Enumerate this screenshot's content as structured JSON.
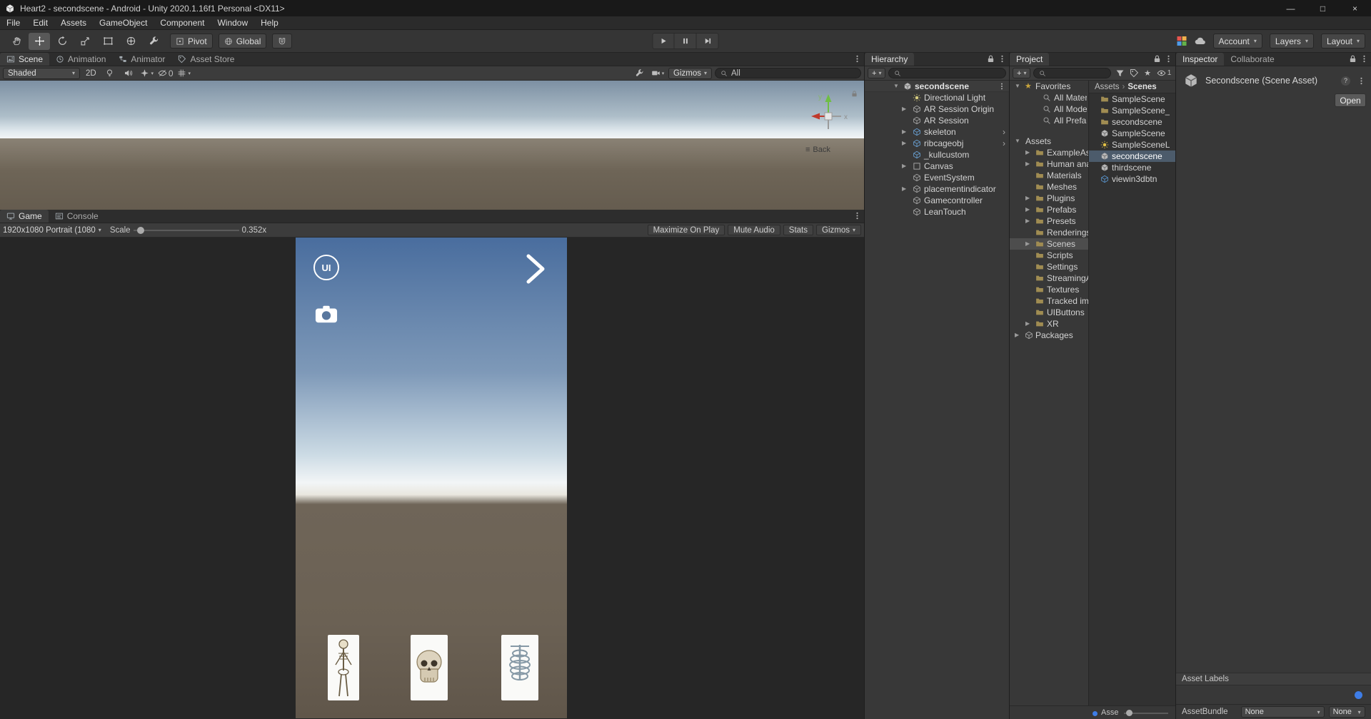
{
  "ui": {
    "caret": "▾",
    "expand": "▶",
    "collapse": "▼",
    "plus": "+",
    "sep": "›",
    "star": "★",
    "menu": "≡",
    "help": "?",
    "prefab_arrow": "›"
  },
  "window": {
    "title": "Heart2 - secondscene - Android - Unity 2020.1.16f1 Personal <DX11>",
    "minimize": "—",
    "maximize": "□",
    "close": "×"
  },
  "menu": {
    "items": [
      "File",
      "Edit",
      "Assets",
      "GameObject",
      "Component",
      "Window",
      "Help"
    ]
  },
  "toolbar": {
    "pivot": "Pivot",
    "global": "Global",
    "account": "Account",
    "layers": "Layers",
    "layout": "Layout"
  },
  "scene": {
    "tabs": [
      "Scene",
      "Animation",
      "Animator",
      "Asset Store"
    ],
    "shaded": "Shaded",
    "two_d": "2D",
    "eye_count": "0",
    "gizmos": "Gizmos",
    "search_value": "All",
    "axis_y": "y",
    "axis_x": "x",
    "view_label": "Back"
  },
  "game": {
    "tabs": [
      "Game",
      "Console"
    ],
    "resolution": "1920x1080 Portrait (1080",
    "scale_label": "Scale",
    "scale_value": "0.352x",
    "maximize_on_play": "Maximize On Play",
    "mute_audio": "Mute Audio",
    "stats": "Stats",
    "gizmos": "Gizmos",
    "app": {
      "ui_label": "UI"
    }
  },
  "hierarchy": {
    "title": "Hierarchy",
    "scene_name": "secondscene",
    "items": [
      {
        "label": "Directional Light"
      },
      {
        "label": "AR Session Origin"
      },
      {
        "label": "AR Session"
      },
      {
        "label": "skeleton"
      },
      {
        "label": "ribcageobj"
      },
      {
        "label": "_kullcustom"
      },
      {
        "label": "Canvas"
      },
      {
        "label": "EventSystem"
      },
      {
        "label": "placementindicator"
      },
      {
        "label": "Gamecontroller"
      },
      {
        "label": "LeanTouch"
      }
    ]
  },
  "project": {
    "title": "Project",
    "hidden_count": "1",
    "favorites": "Favorites",
    "favorite_items": [
      "All Materia",
      "All Models",
      "All Prefabs"
    ],
    "assets": "Assets",
    "folders": [
      "ExampleAs",
      "Human ana",
      "Materials",
      "Meshes",
      "Plugins",
      "Prefabs",
      "Presets",
      "Renderings",
      "Scenes",
      "Scripts",
      "Settings",
      "StreamingA",
      "Textures",
      "Tracked im",
      "UIButtons",
      "XR"
    ],
    "packages": "Packages",
    "breadcrumb_root": "Assets",
    "breadcrumb_current": "Scenes",
    "files": [
      {
        "label": "SampleScene"
      },
      {
        "label": "SampleScene_"
      },
      {
        "label": "secondscene"
      },
      {
        "label": "SampleScene"
      },
      {
        "label": "SampleSceneL"
      },
      {
        "label": "secondscene"
      },
      {
        "label": "thirdscene"
      },
      {
        "label": "viewin3dbtn"
      }
    ],
    "footer_path": "Asse"
  },
  "inspector": {
    "tabs": [
      "Inspector",
      "Collaborate"
    ],
    "asset_title": "Secondscene (Scene Asset)",
    "open_button": "Open",
    "asset_labels": "Asset Labels",
    "assetbundle": "AssetBundle",
    "bundle_none": "None",
    "variant_none": "None"
  }
}
